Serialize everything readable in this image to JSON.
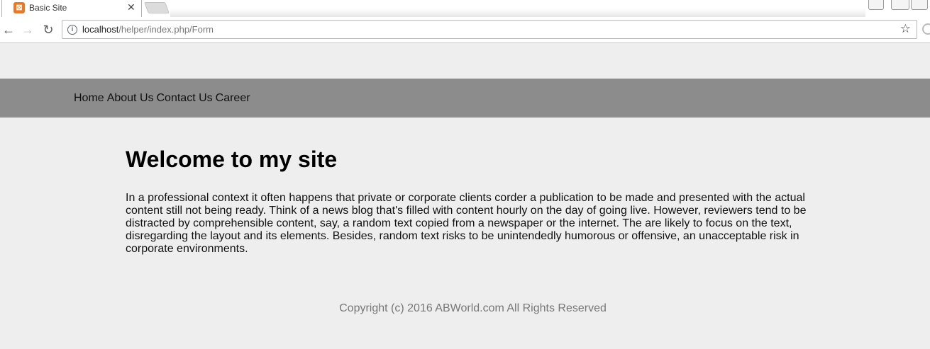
{
  "browser": {
    "tab_title": "Basic Site",
    "tab_close": "✕",
    "url_host": "localhost",
    "url_path": "/helper/index.php/Form",
    "favicon_glyph": "⊠",
    "icons": {
      "back": "back-arrow-icon",
      "forward": "forward-arrow-icon",
      "reload": "reload-icon",
      "info": "info-icon",
      "bookmark": "star-icon"
    }
  },
  "site": {
    "nav": {
      "home": "Home",
      "about": "About Us",
      "contact": "Contact Us",
      "career": "Career"
    },
    "heading": "Welcome to my site",
    "paragraph": "In a professional context it often happens that private or corporate clients corder a publication to be made and presented with the actual content still not being ready. Think of a news blog that's filled with content hourly on the day of going live. However, reviewers tend to be distracted by comprehensible content, say, a random text copied from a newspaper or the internet. The are likely to focus on the text, disregarding the layout and its elements. Besides, random text risks to be unintendedly humorous or offensive, an unacceptable risk in corporate environments.",
    "footer": "Copyright (c) 2016 ABWorld.com All Rights Reserved"
  },
  "colors": {
    "page_background": "#eeeeee",
    "navbar_background": "#8c8c8c",
    "footer_text": "#777777",
    "favicon": "#e8782a"
  }
}
